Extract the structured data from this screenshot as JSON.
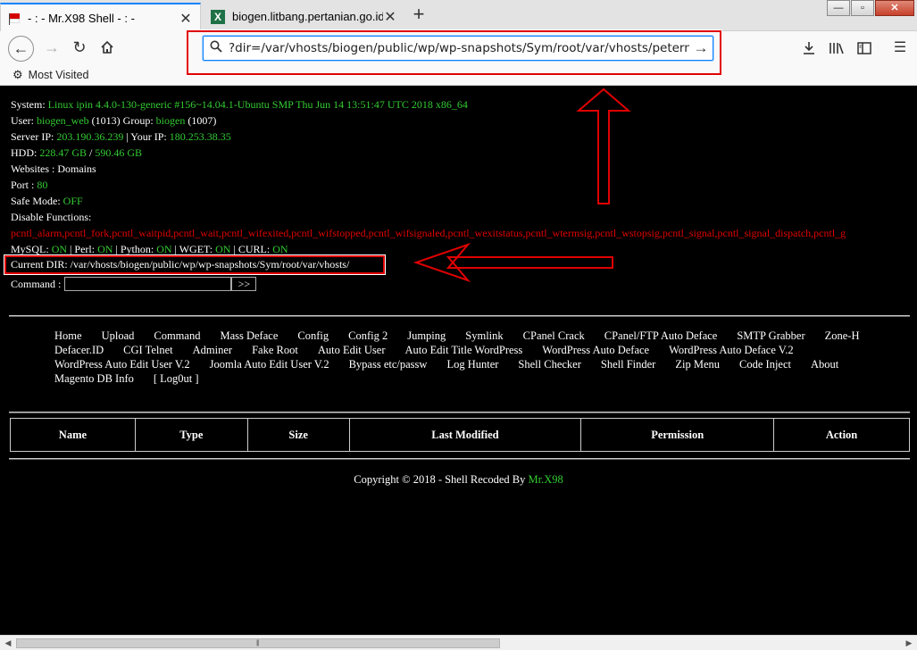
{
  "browser": {
    "tabs": [
      {
        "title": "- : - Mr.X98 Shell - : -",
        "icon": "flag-favicon-icon"
      },
      {
        "title": "biogen.litbang.pertanian.go.id/",
        "icon": "excel-favicon-icon"
      }
    ],
    "url": "?dir=/var/vhosts/biogen/public/wp/wp-snapshots/Sym/root/var/vhosts/peternakan",
    "bookmark": "Most Visited",
    "window_controls": {
      "minimize": "—",
      "maximize": "▫",
      "close": "✕"
    }
  },
  "system_info": {
    "system_label": "System:",
    "system_value": "Linux ipin 4.4.0-130-generic #156~14.04.1-Ubuntu SMP Thu Jun 14 13:51:47 UTC 2018 x86_64",
    "user_label": "User:",
    "user_value": "biogen_web",
    "user_id": "(1013)",
    "group_label": "Group:",
    "group_value": "biogen",
    "group_id": "(1007)",
    "server_ip_label": "Server IP:",
    "server_ip": "203.190.36.239",
    "your_ip_label": "| Your IP:",
    "your_ip": "180.253.38.35",
    "hdd_label": "HDD:",
    "hdd_free": "228.47 GB",
    "hdd_sep": "/",
    "hdd_total": "590.46 GB",
    "websites": "Websites : Domains",
    "port_label": "Port :",
    "port_value": "80",
    "safe_mode_label": "Safe Mode:",
    "safe_mode_value": "OFF",
    "disable_functions_label": "Disable Functions:",
    "disable_functions_value": "pcntl_alarm,pcntl_fork,pcntl_waitpid,pcntl_wait,pcntl_wifexited,pcntl_wifstopped,pcntl_wifsignaled,pcntl_wexitstatus,pcntl_wtermsig,pcntl_wstopsig,pcntl_signal,pcntl_signal_dispatch,pcntl_g",
    "mysql_label": "MySQL:",
    "mysql_value": "ON",
    "perl_label": "| Perl:",
    "perl_value": "ON",
    "python_label": "| Python:",
    "python_value": "ON",
    "wget_label": "| WGET:",
    "wget_value": "ON",
    "curl_label": "| CURL:",
    "curl_value": "ON",
    "current_dir": "Current DIR: /var/vhosts/biogen/public/wp/wp-snapshots/Sym/root/var/vhosts/",
    "command_label": "Command :",
    "command_button": ">>"
  },
  "menu": [
    "Home",
    "Upload",
    "Command",
    "Mass Deface",
    "Config",
    "Config 2",
    "Jumping",
    "Symlink",
    "CPanel Crack",
    "CPanel/FTP Auto Deface",
    "SMTP Grabber",
    "Zone-H",
    "Defacer.ID",
    "CGI Telnet",
    "Adminer",
    "Fake Root",
    "Auto Edit User",
    "Auto Edit Title WordPress",
    "WordPress Auto Deface",
    "WordPress Auto Deface V.2",
    "WordPress Auto Edit User V.2",
    "Joomla Auto Edit User V.2",
    "Bypass etc/passw",
    "Log Hunter",
    "Shell Checker",
    "Shell Finder",
    "Zip Menu",
    "Code Inject",
    "About",
    "Magento DB Info",
    "[ Log0ut ]"
  ],
  "table_headers": [
    "Name",
    "Type",
    "Size",
    "Last Modified",
    "Permission",
    "Action"
  ],
  "footer": {
    "text": "Copyright © 2018 - Shell Recoded By",
    "author": "Mr.X98"
  },
  "colors": {
    "green": "#33cc33",
    "red": "#e00000",
    "background": "#000000"
  }
}
